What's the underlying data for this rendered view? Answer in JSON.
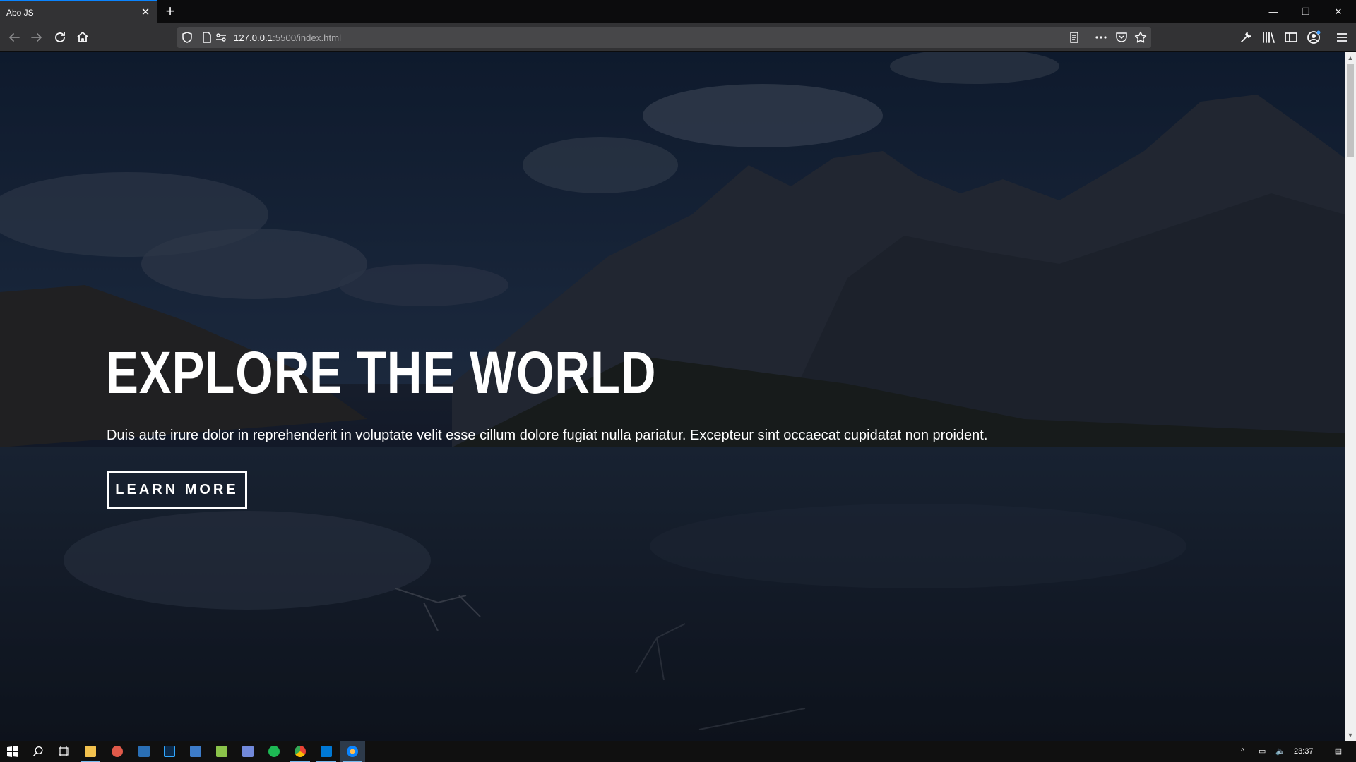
{
  "browser": {
    "tab_title": "Abo JS",
    "url_host": "127.0.0.1",
    "url_rest": ":5500/index.html"
  },
  "hero": {
    "title": "EXPLORE THE WORLD",
    "text": "Duis aute irure dolor in reprehenderit in voluptate velit esse cillum dolore fugiat nulla pariatur. Excepteur sint occaecat cupidatat non proident.",
    "button_label": "LEARN MORE"
  },
  "taskbar": {
    "clock": "23:37"
  },
  "colors": {
    "accent": "#0a84ff",
    "chrome": "#323234",
    "overlay": "#0e1626"
  }
}
